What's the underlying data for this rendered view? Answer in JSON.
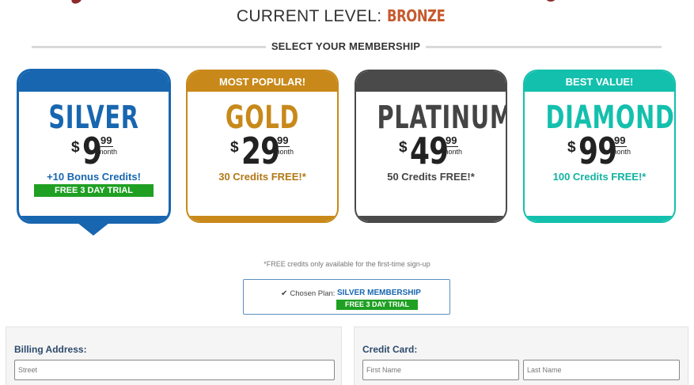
{
  "header": {
    "level_prefix": "CURRENT LEVEL:",
    "level_value": "BRONZE",
    "select_heading": "SELECT YOUR MEMBERSHIP"
  },
  "plans": [
    {
      "id": "silver",
      "band": "",
      "name": "SILVER",
      "currency": "$",
      "price": "9",
      "cents": "99",
      "period": "month",
      "credits": "+10 Bonus Credits!",
      "trial": "FREE 3 DAY TRIAL",
      "color": "#1866b0",
      "selected": true
    },
    {
      "id": "gold",
      "band": "MOST POPULAR!",
      "name": "GOLD",
      "currency": "$",
      "price": "29",
      "cents": "99",
      "period": "month",
      "credits": "30 Credits FREE!*",
      "color": "#c8891a"
    },
    {
      "id": "platinum",
      "band": "",
      "name": "PLATINUM",
      "currency": "$",
      "price": "49",
      "cents": "99",
      "period": "month",
      "credits": "50 Credits FREE!*",
      "color": "#4a4a4a"
    },
    {
      "id": "diamond",
      "band": "BEST VALUE!",
      "name": "DIAMOND",
      "currency": "$",
      "price": "99",
      "cents": "99",
      "period": "month",
      "credits": "100 Credits FREE!*",
      "color": "#13c0ad"
    }
  ],
  "footnote": "*FREE credits only available for the first-time sign-up",
  "chosen": {
    "icon": "check-icon",
    "label": "Chosen Plan:",
    "plan": "SILVER MEMBERSHIP",
    "trial": "FREE 3 DAY TRIAL"
  },
  "billing": {
    "title": "Billing Address:",
    "street_placeholder": "Street"
  },
  "credit_card": {
    "title": "Credit Card:",
    "first_name_placeholder": "First Name",
    "last_name_placeholder": "Last Name"
  }
}
